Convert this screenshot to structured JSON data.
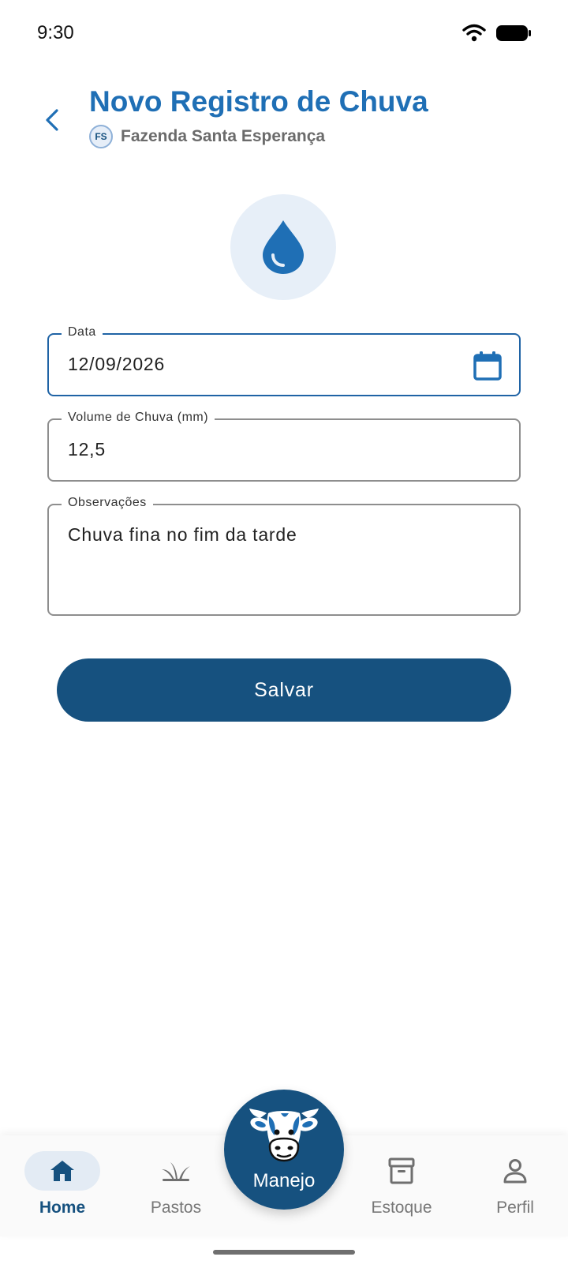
{
  "status_bar": {
    "time": "9:30"
  },
  "header": {
    "title": "Novo Registro de Chuva",
    "farm_initials": "FS",
    "farm_name": "Fazenda Santa Esperança"
  },
  "form": {
    "date": {
      "label": "Data",
      "value": "12/09/2026"
    },
    "volume": {
      "label": "Volume de Chuva (mm)",
      "value": "12,5"
    },
    "notes": {
      "label": "Observações",
      "value": "Chuva fina no fim da tarde"
    },
    "save_label": "Salvar"
  },
  "nav": {
    "items": [
      {
        "label": "Home",
        "icon": "home-icon",
        "active": true
      },
      {
        "label": "Pastos",
        "icon": "grass-icon",
        "active": false
      },
      {
        "label": "Manejo",
        "icon": "cow-icon",
        "active": false
      },
      {
        "label": "Estoque",
        "icon": "archive-icon",
        "active": false
      },
      {
        "label": "Perfil",
        "icon": "person-icon",
        "active": false
      }
    ]
  },
  "colors": {
    "primary": "#16517f",
    "title": "#1f6fb5",
    "accent_soft": "#e7eff8"
  }
}
